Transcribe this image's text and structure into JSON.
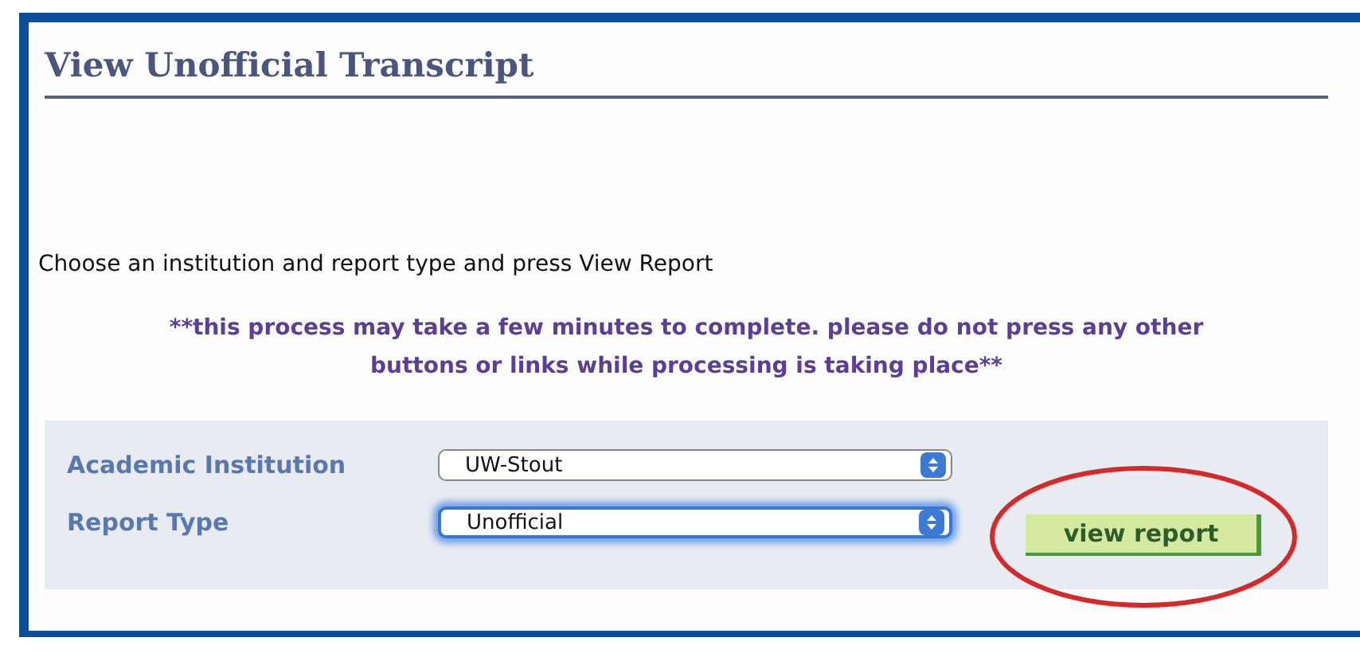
{
  "page_title": "View Unofficial Transcript",
  "instruction": "Choose an institution and report type and press View Report",
  "notice": "**this process may take a few minutes to complete. please do not press any other buttons or links while processing is taking place**",
  "form": {
    "fields": [
      {
        "label": "Academic Institution",
        "value": "UW-Stout",
        "focused": false
      },
      {
        "label": "Report Type",
        "value": "Unofficial",
        "focused": true
      }
    ],
    "button": {
      "label": "view report",
      "circled": true
    }
  }
}
